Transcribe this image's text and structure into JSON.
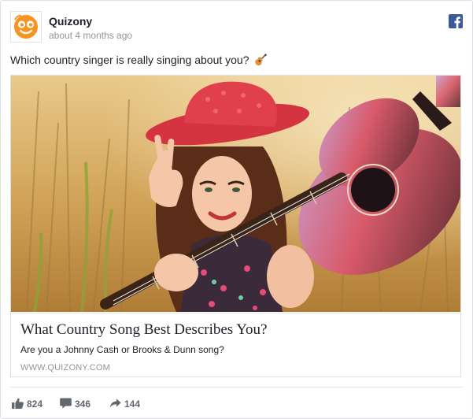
{
  "post": {
    "page_name": "Quizony",
    "timestamp": "about 4 months ago",
    "message": "Which country singer is really singing about you?",
    "message_emoji": "guitar-emoji-icon"
  },
  "link_preview": {
    "title": "What Country Song Best Describes You?",
    "description": "Are you a Johnny Cash or Brooks & Dunn song?",
    "domain": "WWW.QUIZONY.COM"
  },
  "stats": {
    "likes": "824",
    "comments": "346",
    "shares": "144"
  },
  "colors": {
    "brand_orange": "#f7931e",
    "facebook_blue": "#3b5998",
    "stat_gray": "#606770",
    "meta_gray": "#90949c"
  }
}
